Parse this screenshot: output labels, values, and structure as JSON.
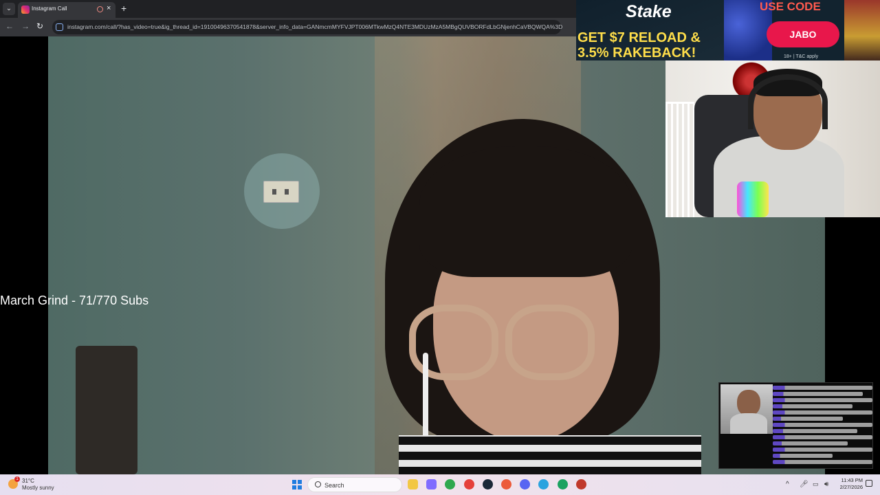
{
  "browser": {
    "tab_title": "Instagram Call",
    "url": "instagram.com/call/?has_video=true&ig_thread_id=19100496370541878&server_info_data=GANmcmMYFVJPT006MTkwMzQ4NTE3MDUzMzA5MBgQUVBORFdLbGNjenhCaVBQWQA%3D"
  },
  "overlay": {
    "grind_text": "March Grind - 71/770 Subs"
  },
  "ad": {
    "brand": "Stake",
    "headline_line1": "GET $7 RELOAD &",
    "headline_line2": "3.5% RAKEBACK!",
    "use_code_label": "USE CODE",
    "code": "JABO",
    "terms": "18+ | T&C apply"
  },
  "taskbar": {
    "weather_temp": "31°C",
    "weather_desc": "Mostly sunny",
    "weather_badge": "1",
    "search_label": "Search",
    "clock_time": "11:43 PM",
    "clock_date": "2/27/2026",
    "apps": [
      {
        "name": "file-explorer-icon",
        "color": "#f2c744"
      },
      {
        "name": "copilot-icon",
        "color": "#7f6bff"
      },
      {
        "name": "chrome-profile-1-icon",
        "color": "#2fa84f"
      },
      {
        "name": "chrome-icon",
        "color": "#e5403a"
      },
      {
        "name": "steam-icon",
        "color": "#1b2838"
      },
      {
        "name": "chrome-profile-2-icon",
        "color": "#ec5b3b"
      },
      {
        "name": "discord-icon",
        "color": "#5865f2"
      },
      {
        "name": "telegram-icon",
        "color": "#2aa3df"
      },
      {
        "name": "obs-icon",
        "color": "#1aa260"
      },
      {
        "name": "chrome-profile-3-icon",
        "color": "#c0392b"
      }
    ]
  },
  "colors": {
    "ad_accent": "#e8174b",
    "ad_headline": "#ffde4a",
    "browser_dark": "#202124"
  }
}
